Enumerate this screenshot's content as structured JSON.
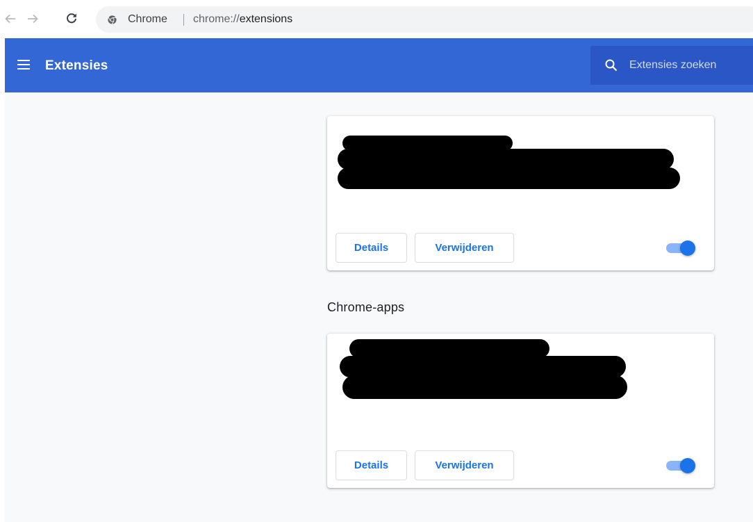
{
  "browser": {
    "origin_label": "Chrome",
    "url_scheme": "chrome://",
    "url_path": "extensions"
  },
  "toolbar": {
    "title": "Extensies",
    "search_placeholder": "Extensies zoeken",
    "color": "#3367d6"
  },
  "sections": {
    "extensions": {
      "cards": [
        {
          "details_label": "Details",
          "remove_label": "Verwijderen",
          "enabled": true
        }
      ]
    },
    "apps": {
      "heading": "Chrome-apps",
      "cards": [
        {
          "details_label": "Details",
          "remove_label": "Verwijderen",
          "enabled": true
        }
      ]
    }
  },
  "colors": {
    "accent": "#1a73e8",
    "toggle_track": "#8ab4f8",
    "content_bg": "#f8f9fa"
  }
}
